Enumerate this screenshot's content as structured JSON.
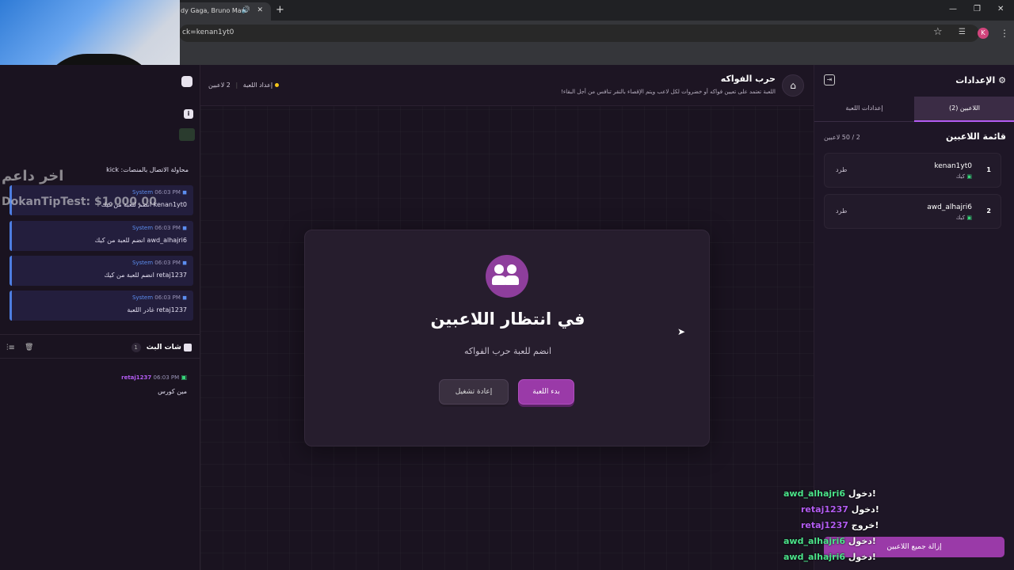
{
  "browser": {
    "tab_title": "dy Gaga, Bruno Mars",
    "address": "ck=kenan1yt0",
    "profile_initial": "K"
  },
  "overlay": {
    "line1": "اخر داعم",
    "line2": "DokanTipTest: $1,000.00"
  },
  "log": {
    "first_message": "محاولة الاتصال بالمنصات: kick",
    "messages": [
      {
        "time": "06:03 PM",
        "sender": "System",
        "text": "kenan1yt0 انضم للعبة من كيك"
      },
      {
        "time": "06:03 PM",
        "sender": "System",
        "text": "awd_alhajri6 انضم للعبة من كيك"
      },
      {
        "time": "06:03 PM",
        "sender": "System",
        "text": "retaj1237 انضم للعبة من كيك"
      },
      {
        "time": "06:03 PM",
        "sender": "System",
        "text": "retaj1237 غادر اللعبة"
      }
    ]
  },
  "chat": {
    "title": "شات البث",
    "count": "1",
    "messages": [
      {
        "user": "retaj1237",
        "time": "06:03 PM",
        "text": "مين كورس"
      }
    ]
  },
  "topbar": {
    "game_title": "حرب الفواكه",
    "game_desc": "اللعبة تعتمد على تعيين فواكه أو خضروات لكل لاعب ويتم الإقصاء بالنقر تنافس من أجل البقاء!",
    "players_count": "2 لاعبين",
    "setup_label": "إعداد اللعبة"
  },
  "modal": {
    "title": "في انتظار اللاعبين",
    "subtitle": "انضم للعبة حرب الفواكه",
    "start_button": "بدء اللعبة",
    "restart_button": "إعادة تشغيل"
  },
  "settings": {
    "title": "الإعدادات",
    "tabs": [
      {
        "label": "اللاعبين (2)",
        "active": true
      },
      {
        "label": "إعدادات اللعبة",
        "active": false
      }
    ],
    "list_title": "قائمة اللاعبين",
    "list_count": "2 / 50 لاعبين",
    "players": [
      {
        "rank": "1",
        "name": "kenan1yt0",
        "platform": "كيك",
        "kick_label": "طرد"
      },
      {
        "rank": "2",
        "name": "awd_alhajri6",
        "platform": "كيك",
        "kick_label": "طرد"
      }
    ],
    "remove_all_button": "إزالة جميع اللاعبين"
  },
  "notifications": [
    {
      "user": "awd_alhajri6",
      "action": "دخول!",
      "color": "#4be38a"
    },
    {
      "user": "retaj1237",
      "action": "دخول!",
      "color": "#b35cf2"
    },
    {
      "user": "retaj1237",
      "action": "خروج!",
      "color": "#b35cf2"
    },
    {
      "user": "awd_alhajri6",
      "action": "دخول!",
      "color": "#4be38a"
    },
    {
      "user": "awd_alhajri6",
      "action": "دخول!",
      "color": "#4be38a"
    }
  ],
  "colors": {
    "accent": "#8e3e9c",
    "kick_green": "#37d67a",
    "system_blue": "#5c8ef0"
  }
}
